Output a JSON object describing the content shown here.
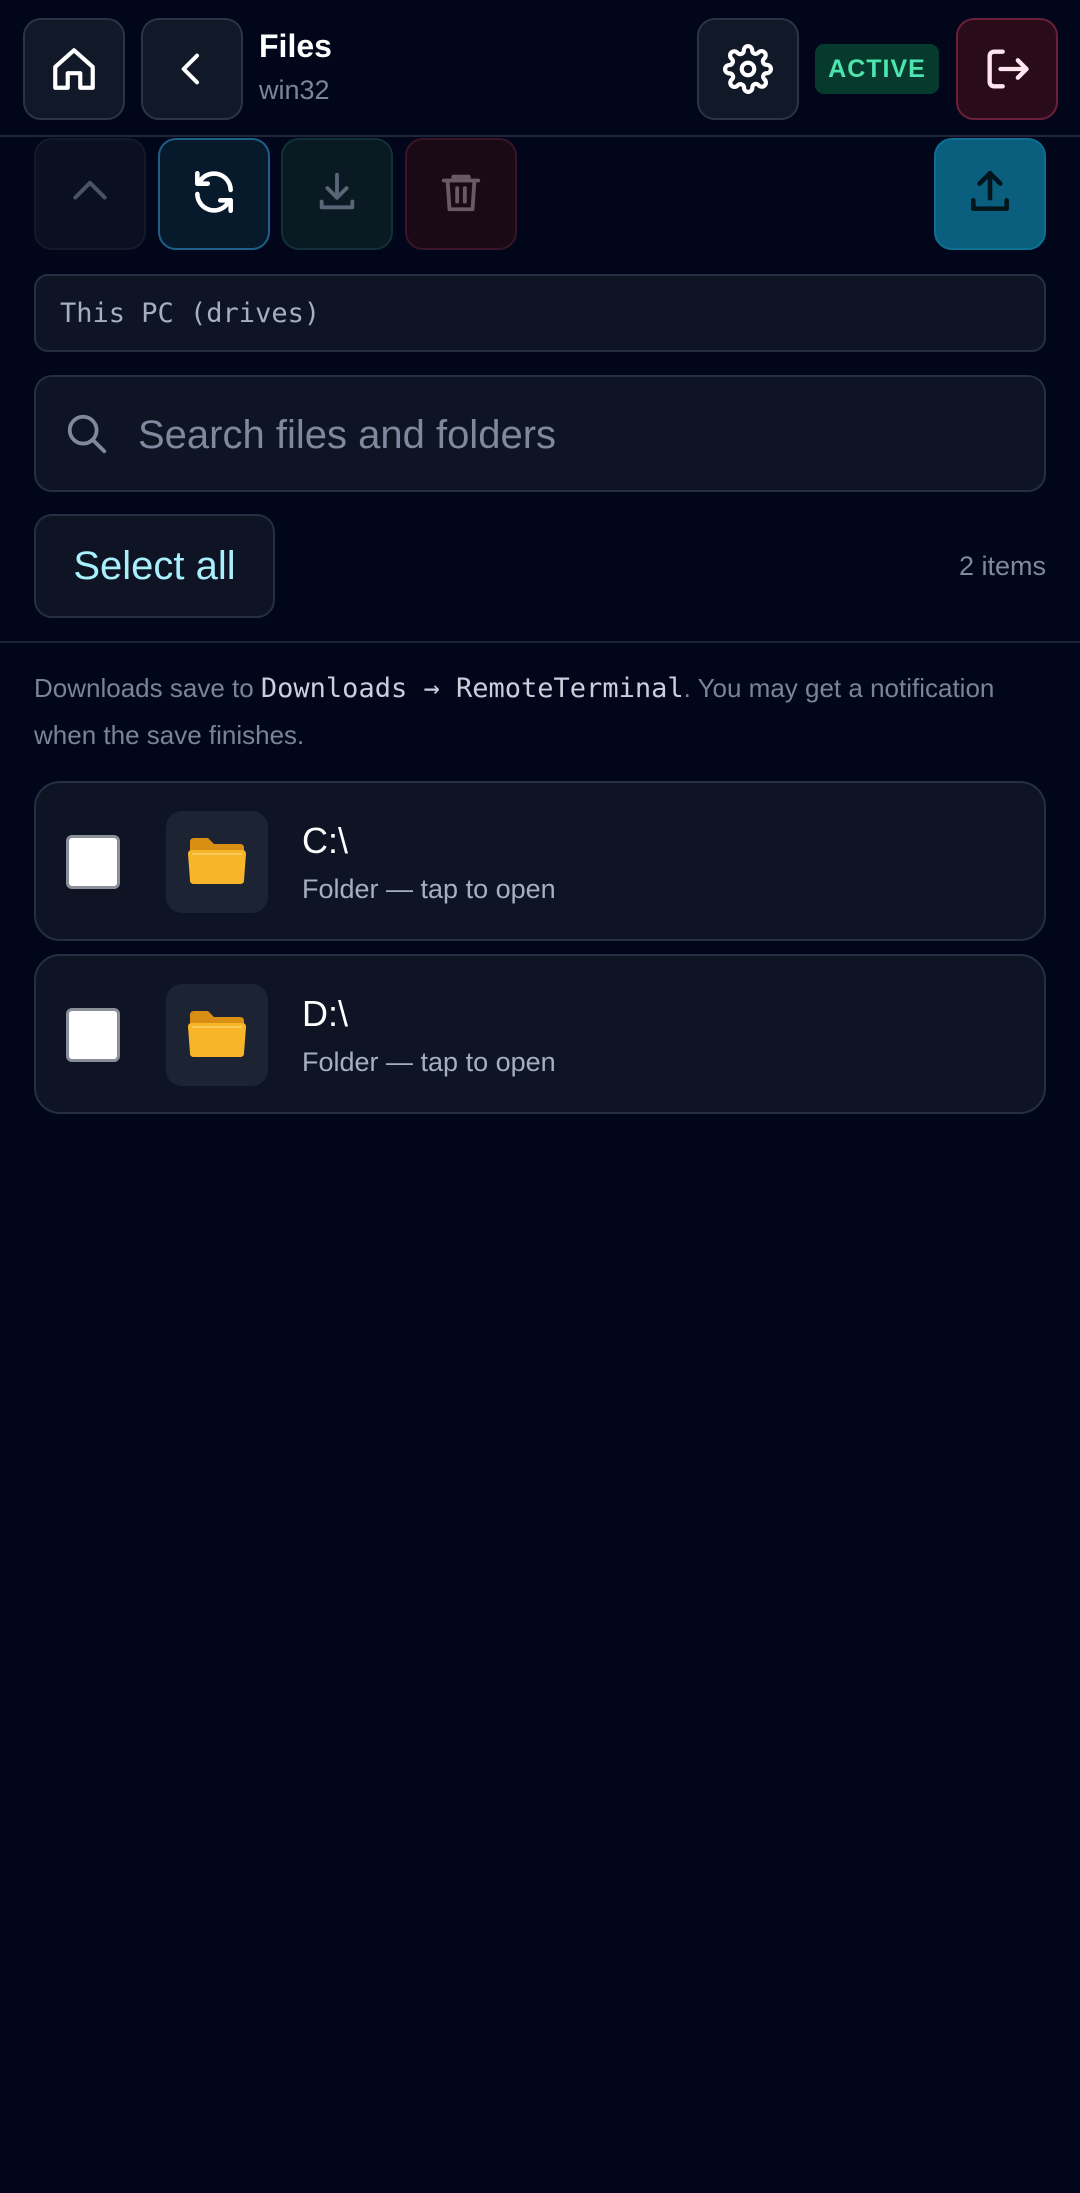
{
  "header": {
    "title": "Files",
    "subtitle": "win32",
    "status_badge": "ACTIVE",
    "icons": {
      "home": "home-icon",
      "back": "chevron-left-icon",
      "settings": "gear-icon",
      "logout": "logout-icon"
    }
  },
  "toolbar": {
    "icons": [
      "chevron-up-icon",
      "refresh-icon",
      "download-icon",
      "trash-icon",
      "upload-icon"
    ]
  },
  "path": {
    "value": "This PC (drives)"
  },
  "search": {
    "placeholder": "Search files and folders",
    "value": ""
  },
  "selection": {
    "select_all_label": "Select all",
    "item_count": "2 items"
  },
  "note": {
    "prefix": "Downloads save to ",
    "folder": "Downloads",
    "arrow": "→",
    "subfolder": "RemoteTerminal",
    "suffix": ". You may get a notification when the save finishes."
  },
  "files": [
    {
      "name": "C:\\",
      "meta": "Folder — tap to open",
      "icon": "folder-icon",
      "checked": false
    },
    {
      "name": "D:\\",
      "meta": "Folder — tap to open",
      "icon": "folder-icon",
      "checked": false
    }
  ],
  "colors": {
    "background": "#02061a",
    "accent": "#a8f0fb",
    "active_badge_text": "#4ee4ad",
    "upload_button": "#0a5f7f",
    "logout_border": "#6b1f3b",
    "folder": "#f5b323"
  }
}
